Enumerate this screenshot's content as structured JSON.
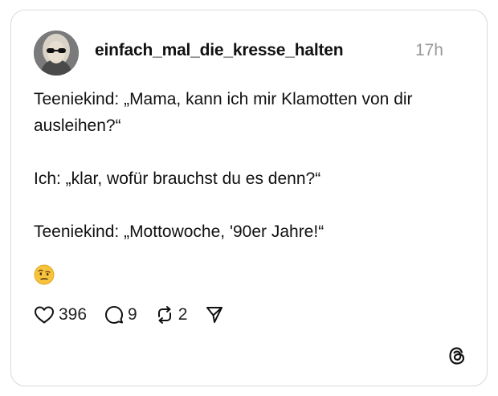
{
  "post": {
    "username": "einfach_mal_die_kresse_halten",
    "timestamp": "17h",
    "lines": [
      "Teeniekind: „Mama, kann ich mir Klamotten von dir ausleihen?“",
      "Ich: „klar, wofür brauchst du es denn?“",
      "Teeniekind: „Mottowoche, '90er Jahre!“"
    ],
    "emoji_icon": "face-with-raised-eyebrow-icon"
  },
  "actions": {
    "likes": "396",
    "comments": "9",
    "reposts": "2"
  },
  "icons": {
    "like": "heart-icon",
    "comment": "comment-bubble-icon",
    "repost": "repost-icon",
    "share": "send-icon",
    "brand": "threads-logo-icon"
  },
  "colors": {
    "text": "#111111",
    "muted": "#999999",
    "border": "#d9d9d9",
    "emoji": "#f7c33d"
  }
}
